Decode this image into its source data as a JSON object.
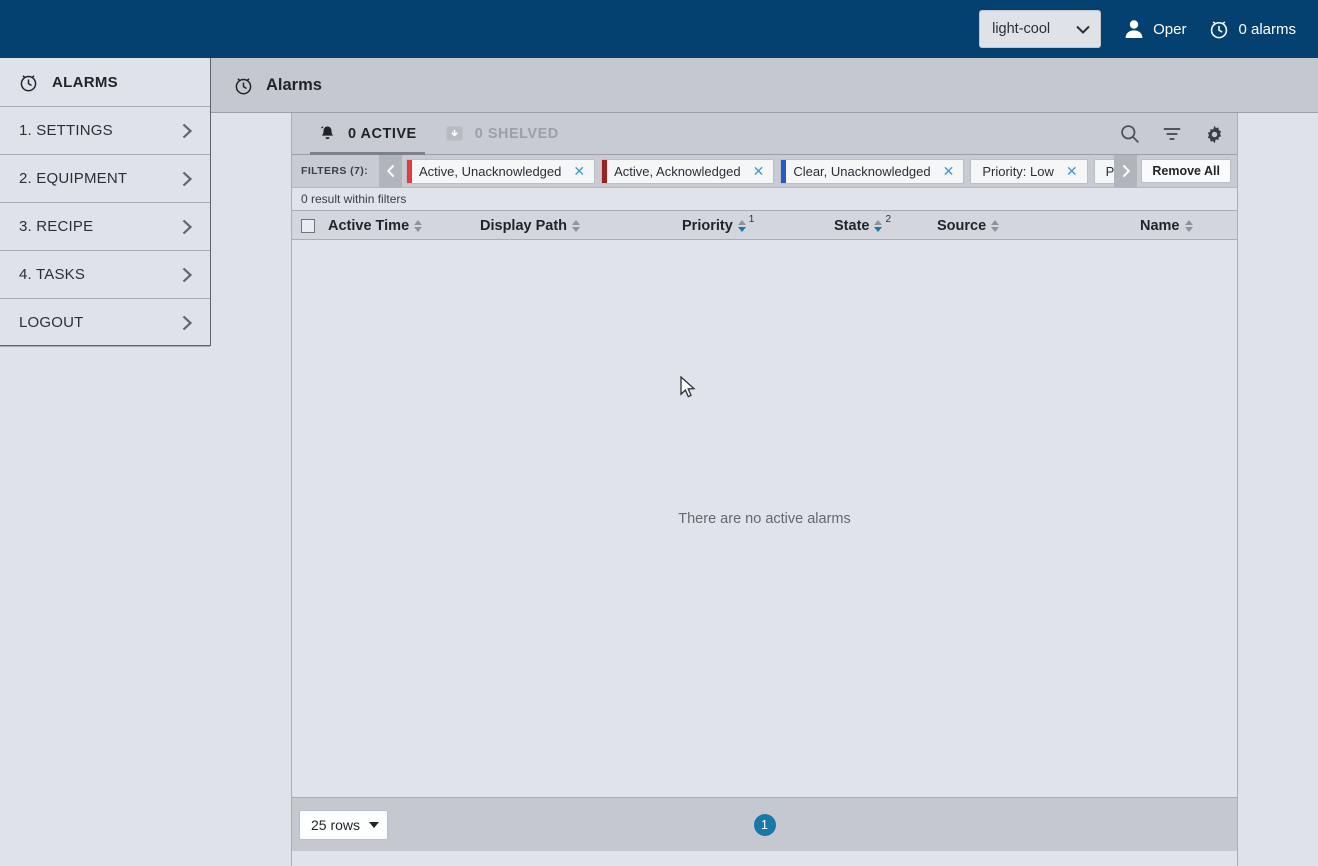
{
  "topbar": {
    "theme_value": "light-cool",
    "theme_caret": "chevron-down-icon",
    "user_icon": "person-icon",
    "user_label": "Oper",
    "alarm_icon": "alarm-clock-icon",
    "alarm_label": "0 alarms",
    "background_color": "#044170"
  },
  "sidebar": {
    "header": {
      "icon": "alarm-clock-icon",
      "label": "ALARMS"
    },
    "items": [
      {
        "label": "1. SETTINGS",
        "chevron": "chevron-right-icon"
      },
      {
        "label": "2. EQUIPMENT",
        "chevron": "chevron-right-icon"
      },
      {
        "label": "3. RECIPE",
        "chevron": "chevron-right-icon"
      },
      {
        "label": "4. TASKS",
        "chevron": "chevron-right-icon"
      },
      {
        "label": "LOGOUT",
        "chevron": "chevron-right-icon"
      }
    ]
  },
  "main_header": {
    "icon": "alarm-clock-icon",
    "title": "Alarms"
  },
  "panel": {
    "tabs": [
      {
        "icon": "bell-icon",
        "label": "0 ACTIVE",
        "active": true
      },
      {
        "icon": "shelve-box-icon",
        "label": "0 SHELVED",
        "active": false
      }
    ],
    "toolbar": [
      {
        "name": "search-icon",
        "title": "Search"
      },
      {
        "name": "filter-icon",
        "title": "Filter"
      },
      {
        "name": "gear-icon",
        "title": "Settings"
      }
    ],
    "filters": {
      "label": "FILTERS (7):",
      "scroll_left": "chevron-left-icon",
      "scroll_right": "chevron-right-icon",
      "remove_all_label": "Remove All",
      "chips": [
        {
          "label": "Active, Unacknowledged",
          "color": "#e23c3c",
          "close": "close-icon"
        },
        {
          "label": "Active, Acknowledged",
          "color": "#a02020",
          "close": "close-icon"
        },
        {
          "label": "Clear, Unacknowledged",
          "color": "#2558c8",
          "close": "close-icon"
        },
        {
          "label": "Priority: Low",
          "color": "#c8ccd2",
          "close": "close-icon"
        },
        {
          "label": "Priority: Medium",
          "color": "#c8ccd2",
          "close": "close-icon"
        }
      ]
    },
    "result_count": "0 result within filters",
    "table": {
      "select_all_checkbox": "unchecked",
      "columns": [
        {
          "label": "Active Time",
          "sort": "none",
          "sort_rank": ""
        },
        {
          "label": "Display Path",
          "sort": "none",
          "sort_rank": ""
        },
        {
          "label": "Priority",
          "sort": "desc",
          "sort_rank": "1"
        },
        {
          "label": "State",
          "sort": "desc",
          "sort_rank": "2"
        },
        {
          "label": "Source",
          "sort": "none",
          "sort_rank": ""
        },
        {
          "label": "Name",
          "sort": "none",
          "sort_rank": ""
        }
      ],
      "rows": [],
      "empty_message": "There are no active alarms"
    },
    "footer": {
      "rows_per_page": "25 rows",
      "current_page": "1"
    }
  }
}
